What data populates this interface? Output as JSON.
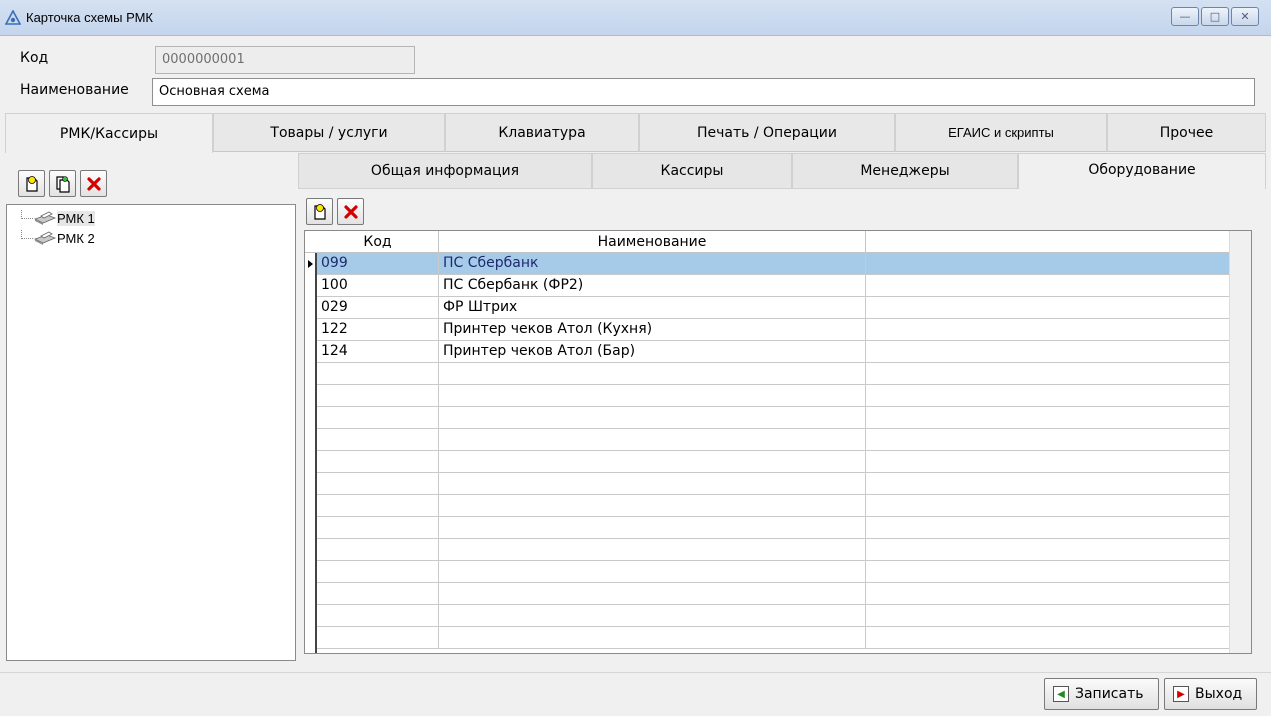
{
  "window": {
    "title": "Карточка схемы РМК"
  },
  "fields": {
    "code_label": "Код",
    "code_value": "0000000001",
    "name_label": "Наименование",
    "name_value": "Основная схема"
  },
  "tabs": [
    {
      "label": "РМК/Кассиры",
      "active": true
    },
    {
      "label": "Товары / услуги"
    },
    {
      "label": "Клавиатура"
    },
    {
      "label": "Печать / Операции"
    },
    {
      "label": "ЕГАИС и скрипты"
    },
    {
      "label": "Прочее"
    }
  ],
  "tree": {
    "items": [
      {
        "label": "РМК 1",
        "selected": true
      },
      {
        "label": "РМК 2"
      }
    ]
  },
  "subtabs": [
    {
      "label": "Общая информация"
    },
    {
      "label": "Кассиры"
    },
    {
      "label": "Менеджеры"
    },
    {
      "label": "Оборудование",
      "active": true
    }
  ],
  "grid": {
    "columns": [
      "Код",
      "Наименование"
    ],
    "rows": [
      {
        "code": "099",
        "name": "ПС Сбербанк",
        "selected": true
      },
      {
        "code": "100",
        "name": "ПС Сбербанк (ФР2)"
      },
      {
        "code": "029",
        "name": "ФР Штрих"
      },
      {
        "code": "122",
        "name": "Принтер чеков Атол (Кухня)"
      },
      {
        "code": "124",
        "name": "Принтер чеков Атол (Бар)"
      }
    ]
  },
  "footer": {
    "save_label": "Записать",
    "exit_label": "Выход"
  },
  "colors": {
    "selection": "#a6cbe9",
    "delete_icon": "#d40000"
  }
}
